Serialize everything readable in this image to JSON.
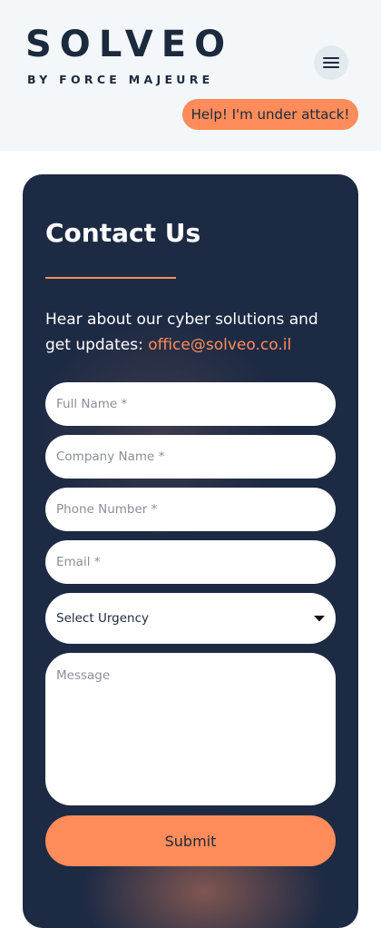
{
  "header": {
    "logo_word": "SOLVEO",
    "logo_sub": "BY FORCE MAJEURE",
    "menu_icon": "hamburger-menu-icon",
    "attack_button_label": "Help! I'm under attack!"
  },
  "contact": {
    "title": "Contact Us",
    "intro": "Hear about our cyber solutions and get updates: ",
    "email": "office@solveo.co.il",
    "fields": {
      "full_name_placeholder": "Full Name *",
      "company_name_placeholder": "Company Name *",
      "phone_number_placeholder": "Phone Number *",
      "email_placeholder": "Email *",
      "urgency_selected": "Select Urgency",
      "message_placeholder": "Message"
    },
    "submit_label": "Submit"
  },
  "colors": {
    "accent": "#ff8c5a",
    "card_background": "#1d2a44",
    "header_background": "#f3f7f9",
    "brand_text": "#1c2a3e"
  }
}
